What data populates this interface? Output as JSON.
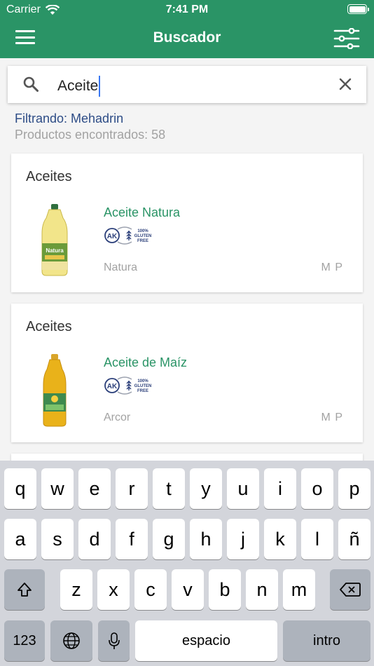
{
  "status_bar": {
    "carrier": "Carrier",
    "time": "7:41 PM"
  },
  "nav": {
    "title": "Buscador"
  },
  "search": {
    "query": "Aceite"
  },
  "results": {
    "filter_label": "Filtrando: Mehadrin",
    "count_label": "Productos encontrados: 58"
  },
  "products": [
    {
      "category": "Aceites",
      "name": "Aceite Natura",
      "brand": "Natura",
      "tag": "M P",
      "logo_text": "100% GLUTEN FREE",
      "logo_lines": [
        "100%",
        "GLUTEN",
        "FREE"
      ],
      "logo_mark": "AK"
    },
    {
      "category": "Aceites",
      "name": "Aceite de Maíz",
      "brand": "Arcor",
      "tag": "M P",
      "logo_text": "100% GLUTEN FREE",
      "logo_lines": [
        "100%",
        "GLUTEN",
        "FREE"
      ],
      "logo_mark": "AK"
    }
  ],
  "keyboard": {
    "row1": [
      "q",
      "w",
      "e",
      "r",
      "t",
      "y",
      "u",
      "i",
      "o",
      "p"
    ],
    "row2": [
      "a",
      "s",
      "d",
      "f",
      "g",
      "h",
      "j",
      "k",
      "l",
      "ñ"
    ],
    "row3": [
      "z",
      "x",
      "c",
      "v",
      "b",
      "n",
      "m"
    ],
    "numbers_label": "123",
    "space_label": "espacio",
    "return_label": "intro"
  },
  "colors": {
    "header": "#2a9466",
    "accent": "#2a9466",
    "filter_text": "#2d4c86",
    "caret": "#3a78f2"
  },
  "icons": [
    "wifi-icon",
    "battery-icon",
    "menu-icon",
    "filter-sliders-icon",
    "search-icon",
    "clear-icon",
    "shift-icon",
    "backspace-icon",
    "globe-icon",
    "microphone-icon"
  ]
}
